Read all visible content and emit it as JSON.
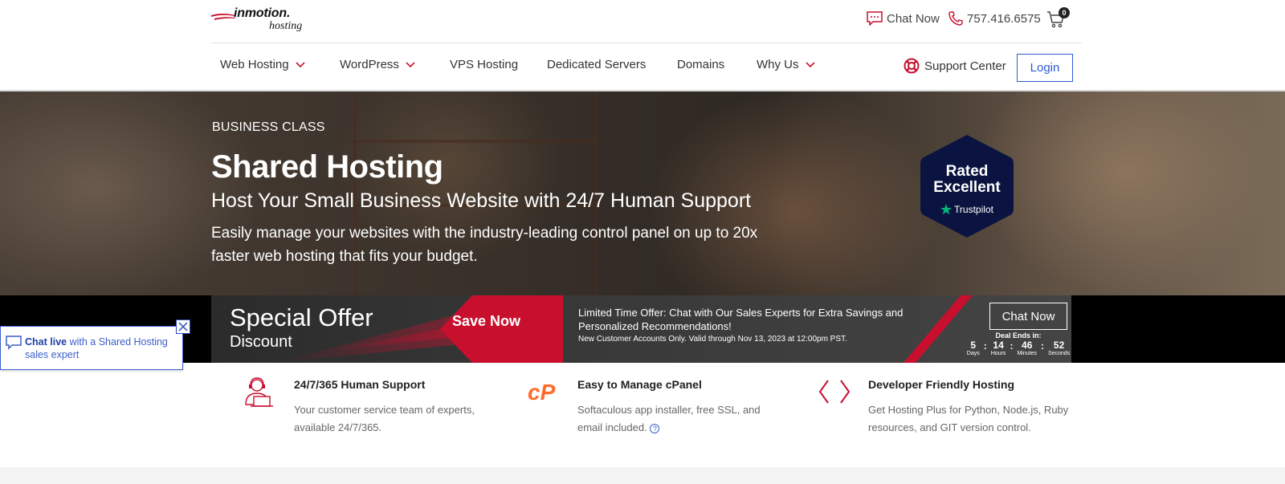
{
  "header": {
    "logo_brand": "inmotion.",
    "logo_sub": "hosting",
    "chat_label": "Chat Now",
    "phone": "757.416.6575",
    "cart_count": "0"
  },
  "nav": {
    "items": [
      {
        "label": "Web Hosting"
      },
      {
        "label": "WordPress"
      },
      {
        "label": "VPS Hosting"
      },
      {
        "label": "Dedicated Servers"
      },
      {
        "label": "Domains"
      },
      {
        "label": "Why Us"
      }
    ],
    "support_label": "Support Center",
    "login_label": "Login"
  },
  "hero": {
    "eyebrow": "BUSINESS CLASS",
    "title": "Shared Hosting",
    "tagline": "Host Your Small Business Website with 24/7 Human Support",
    "description": "Easily manage your websites with the industry-leading control panel on up to 20x faster web hosting that fits your budget.",
    "badge_line1": "Rated",
    "badge_line2": "Excellent",
    "badge_brand": "Trustpilot"
  },
  "offer": {
    "title": "Special Offer",
    "subtitle": "Discount",
    "save_label": "Save Now",
    "limited_text": "Limited Time Offer: Chat with Our Sales Experts for Extra Savings and Personalized Recommendations!",
    "fine_print": "New Customer Accounts Only. Valid through Nov 13, 2023 at 12:00pm PST.",
    "chat_label": "Chat Now",
    "deal_label": "Deal Ends in:",
    "timer": {
      "days": "5",
      "days_label": "Days",
      "hours": "14",
      "hours_label": "Hours",
      "minutes": "46",
      "minutes_label": "Minutes",
      "seconds": "52",
      "seconds_label": "Seconds"
    }
  },
  "chat_widget": {
    "bold": "Chat live",
    "rest": " with a Shared Hosting sales expert"
  },
  "features": [
    {
      "title": "24/7/365 Human Support",
      "text": "Your customer service team of experts, available 24/7/365."
    },
    {
      "title": "Easy to Manage cPanel",
      "text": "Softaculous app installer, free SSL, and email included.",
      "help": "?"
    },
    {
      "title": "Developer Friendly Hosting",
      "text": "Get Hosting Plus for Python, Node.js, Ruby resources, and GIT version control."
    }
  ],
  "colors": {
    "accent_red": "#c8102e",
    "link_blue": "#2d5bd0",
    "badge_navy": "#0b1440",
    "trustpilot_green": "#00b67a",
    "cpanel_orange": "#ff6c2c"
  }
}
